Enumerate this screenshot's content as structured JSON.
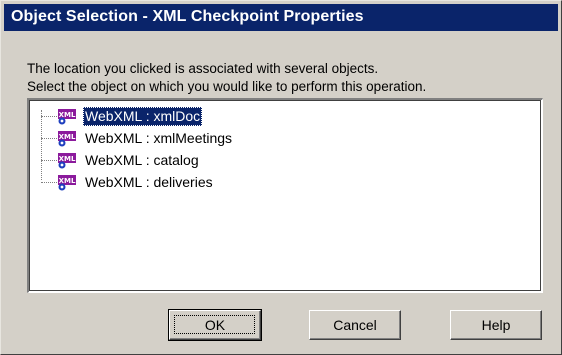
{
  "dialog": {
    "title": "Object Selection - XML Checkpoint Properties",
    "prompt_line1": "The location you clicked is associated with several objects.",
    "prompt_line2": "Select the object on which you would like to perform this operation."
  },
  "objects": {
    "icon": "xml-object-icon",
    "icon_text": "XML",
    "items": [
      {
        "label": "WebXML : xmlDoc",
        "selected": true
      },
      {
        "label": "WebXML : xmlMeetings",
        "selected": false
      },
      {
        "label": "WebXML : catalog",
        "selected": false
      },
      {
        "label": "WebXML : deliveries",
        "selected": false
      }
    ]
  },
  "buttons": {
    "ok": "OK",
    "cancel": "Cancel",
    "help": "Help"
  },
  "colors": {
    "titlebar": "#0a246a",
    "selection": "#0a246a",
    "dialog_face": "#d4d0c8",
    "icon_purple": "#8b1a9c",
    "icon_blue": "#1f3fbf"
  }
}
